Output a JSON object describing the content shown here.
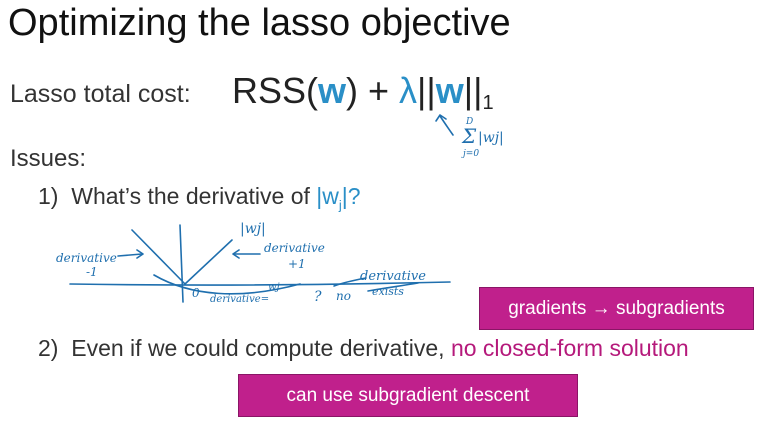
{
  "title": "Optimizing the lasso objective",
  "cost": {
    "label": "Lasso total cost:",
    "rss": "RSS(",
    "w1": "w",
    "close_plus": ") + ",
    "lambda": "λ",
    "bars_left": "||",
    "w2": "w",
    "bars_right": "||",
    "sub": "1"
  },
  "annotation_sum": {
    "upper": "D",
    "sigma": "Σ",
    "term": "|wj|",
    "lower": "j=0"
  },
  "issues": {
    "heading": "Issues:",
    "issue1": {
      "num": "1)",
      "text": "What’s the derivative of ",
      "abs": "|w",
      "sub": "j",
      "end": "|?"
    },
    "issue2": {
      "num": "2)",
      "text": "Even if we could compute derivative, ",
      "highlight": "no closed-form solution"
    }
  },
  "sketch": {
    "abs_label": "|wj|",
    "deriv_left": "derivative",
    "deriv_left_val": "-1",
    "deriv_right": "derivative",
    "deriv_right_val": "+1",
    "origin": "0",
    "bottom_label": "derivative=",
    "bottom_w": "wj",
    "question": "?",
    "no_deriv_1": "no",
    "no_deriv_2": "derivative",
    "no_deriv_3": "exists"
  },
  "boxes": {
    "box1": "gradients → subgradients",
    "box2": "can use subgradient descent"
  },
  "colors": {
    "accent_blue": "#2a8fc7",
    "ink_blue": "#1f6fae",
    "magenta": "#b5197b",
    "box_fill": "#c0208c"
  }
}
